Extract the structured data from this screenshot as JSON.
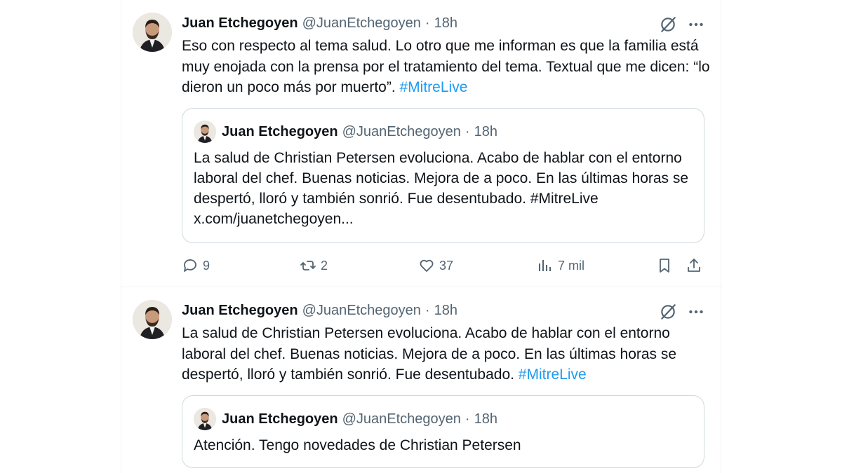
{
  "tweets": [
    {
      "author": {
        "name": "Juan Etchegoyen",
        "handle": "@JuanEtchegoyen",
        "separator": "·",
        "time": "18h"
      },
      "text": "Eso con respecto al tema salud. Lo otro que me informan es que la familia está muy enojada con la prensa por el tratamiento del tema. Textual que me dicen: “lo dieron un poco más por muerto”. ",
      "hashtag": "#MitreLive",
      "quote": {
        "author": {
          "name": "Juan Etchegoyen",
          "handle": "@JuanEtchegoyen",
          "separator": "·",
          "time": "18h"
        },
        "text": "La salud de Christian Petersen evoluciona. Acabo de hablar con el entorno laboral del chef. Buenas noticias. Mejora de a poco. En las últimas horas se despertó, lloró y también sonrió. Fue desentubado. #MitreLive x.com/juanetchegoyen..."
      },
      "actions": {
        "replies": "9",
        "reposts": "2",
        "likes": "37",
        "views": "7 mil"
      }
    },
    {
      "author": {
        "name": "Juan Etchegoyen",
        "handle": "@JuanEtchegoyen",
        "separator": "·",
        "time": "18h"
      },
      "text": "La salud de Christian Petersen evoluciona. Acabo de hablar con el entorno laboral del chef. Buenas noticias. Mejora de a poco. En las últimas horas se despertó, lloró y también sonrió. Fue desentubado. ",
      "hashtag": "#MitreLive",
      "quote": {
        "author": {
          "name": "Juan Etchegoyen",
          "handle": "@JuanEtchegoyen",
          "separator": "·",
          "time": "18h"
        },
        "text": "Atención. Tengo novedades de Christian Petersen"
      }
    }
  ],
  "icons": {
    "grok": "grok-icon",
    "more": "more-icon",
    "reply": "reply-icon",
    "repost": "repost-icon",
    "like": "like-icon",
    "views": "views-icon",
    "bookmark": "bookmark-icon",
    "share": "share-icon"
  },
  "colors": {
    "hashtag": "#1d9bf0",
    "secondary": "#536471",
    "border": "#cfd9de"
  }
}
